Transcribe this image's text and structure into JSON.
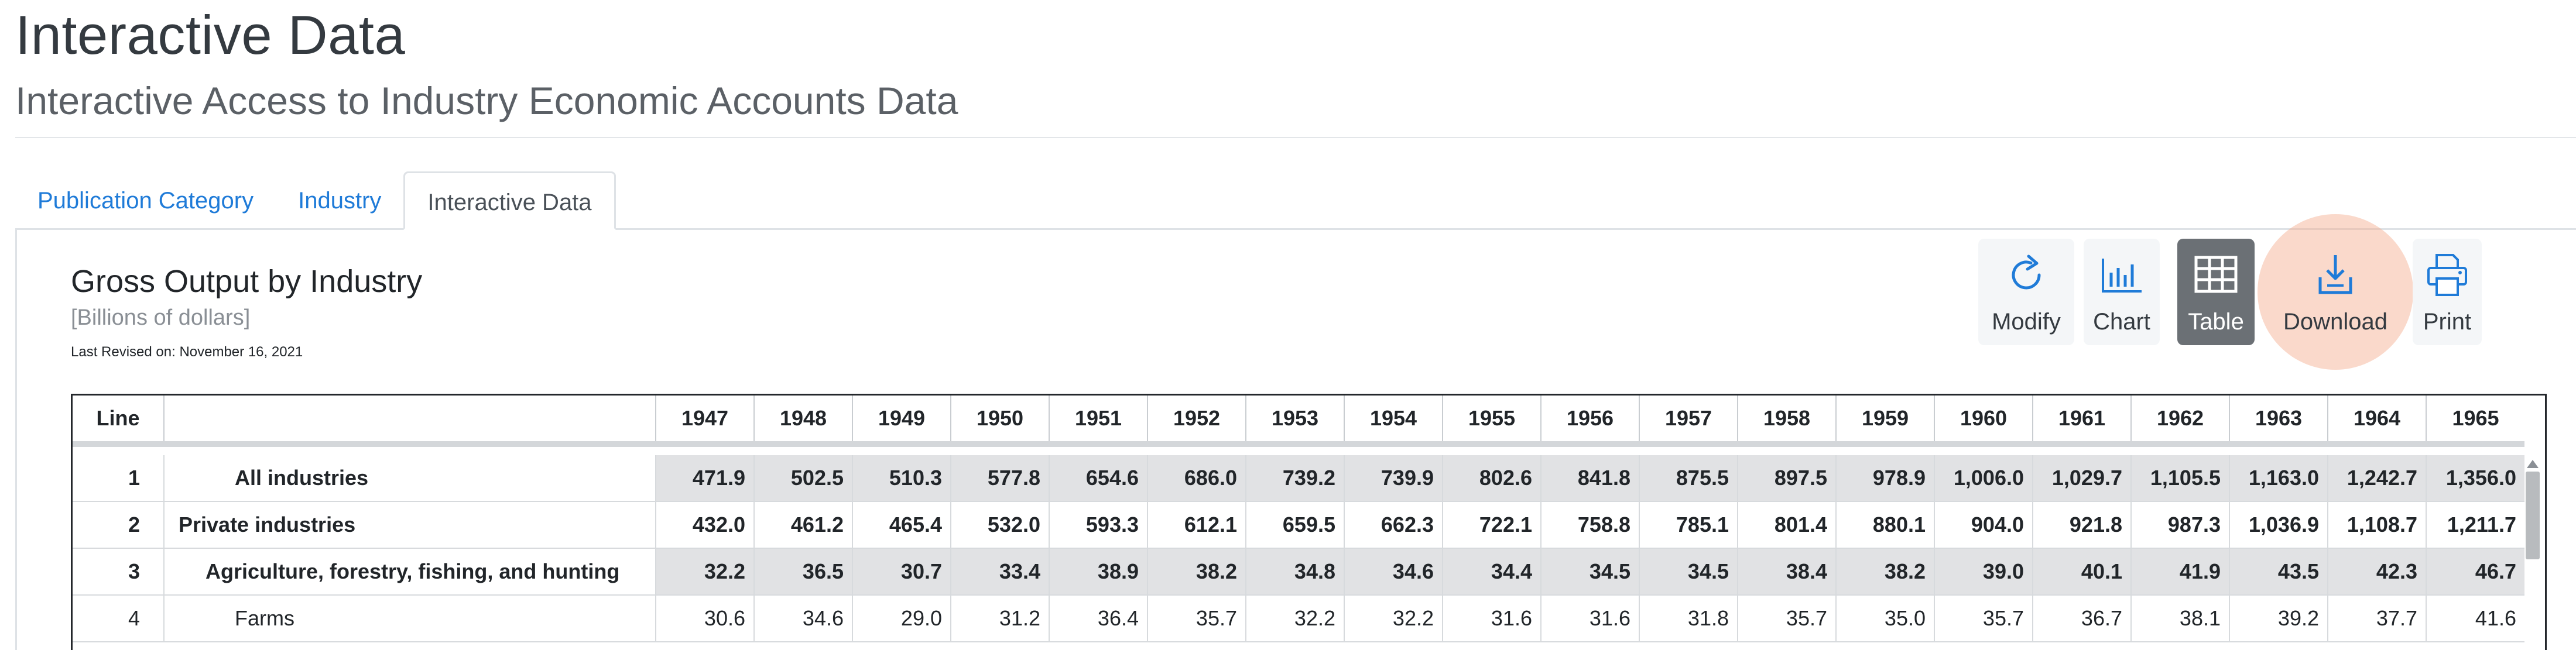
{
  "header": {
    "title": "Interactive Data",
    "subtitle": "Interactive Access to Industry Economic Accounts Data"
  },
  "tabs": [
    {
      "label": "Publication Category"
    },
    {
      "label": "Industry"
    },
    {
      "label": "Interactive Data",
      "active": true
    }
  ],
  "table_header": {
    "title": "Gross Output by Industry",
    "units": "[Billions of dollars]",
    "revised": "Last Revised on: November 16, 2021"
  },
  "toolbar": {
    "modify": "Modify",
    "chart": "Chart",
    "table": "Table",
    "download": "Download",
    "print": "Print",
    "active": "Table",
    "accent_color": "#1f7bd8"
  },
  "grid": {
    "line_header": "Line",
    "name_header": "",
    "years": [
      "1947",
      "1948",
      "1949",
      "1950",
      "1951",
      "1952",
      "1953",
      "1954",
      "1955",
      "1956",
      "1957",
      "1958",
      "1959",
      "1960",
      "1961",
      "1962",
      "1963",
      "1964",
      "1965"
    ],
    "rows": [
      {
        "line": "1",
        "name": "All industries",
        "indent": 2,
        "bold": true,
        "shaded": true,
        "values": [
          "471.9",
          "502.5",
          "510.3",
          "577.8",
          "654.6",
          "686.0",
          "739.2",
          "739.9",
          "802.6",
          "841.8",
          "875.5",
          "897.5",
          "978.9",
          "1,006.0",
          "1,029.7",
          "1,105.5",
          "1,163.0",
          "1,242.7",
          "1,356.0"
        ]
      },
      {
        "line": "2",
        "name": "Private industries",
        "indent": 0,
        "bold": true,
        "shaded": false,
        "values": [
          "432.0",
          "461.2",
          "465.4",
          "532.0",
          "593.3",
          "612.1",
          "659.5",
          "662.3",
          "722.1",
          "758.8",
          "785.1",
          "801.4",
          "880.1",
          "904.0",
          "921.8",
          "987.3",
          "1,036.9",
          "1,108.7",
          "1,211.7"
        ]
      },
      {
        "line": "3",
        "name": "Agriculture, forestry, fishing, and hunting",
        "indent": 1,
        "bold": true,
        "shaded": true,
        "values": [
          "32.2",
          "36.5",
          "30.7",
          "33.4",
          "38.9",
          "38.2",
          "34.8",
          "34.6",
          "34.4",
          "34.5",
          "34.5",
          "38.4",
          "38.2",
          "39.0",
          "40.1",
          "41.9",
          "43.5",
          "42.3",
          "46.7"
        ]
      },
      {
        "line": "4",
        "name": "Farms",
        "indent": 2,
        "bold": false,
        "shaded": false,
        "values": [
          "30.6",
          "34.6",
          "29.0",
          "31.2",
          "36.4",
          "35.7",
          "32.2",
          "32.2",
          "31.6",
          "31.6",
          "31.8",
          "35.7",
          "35.0",
          "35.7",
          "36.7",
          "38.1",
          "39.2",
          "37.7",
          "41.6"
        ]
      }
    ]
  },
  "colors": {
    "link": "#1f7bd8",
    "active_button": "#6b7075",
    "download_highlight": "#f4aa8c",
    "shaded_cell": "#e1e2e4"
  }
}
